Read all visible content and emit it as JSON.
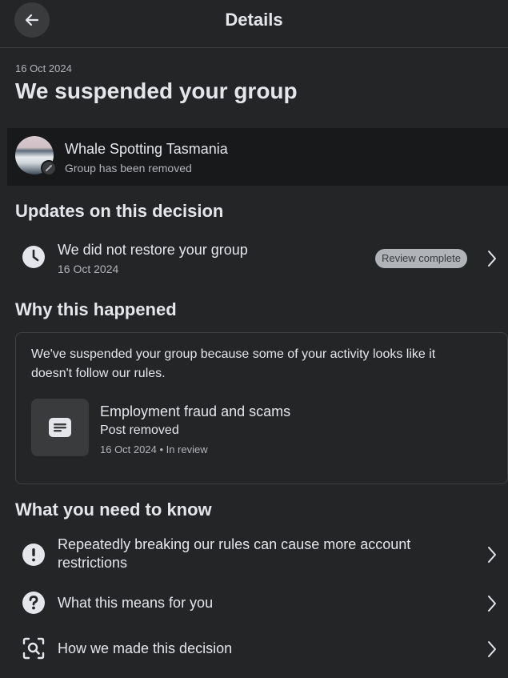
{
  "header": {
    "title": "Details"
  },
  "notice": {
    "date": "16 Oct 2024",
    "title": "We suspended your group"
  },
  "group": {
    "name": "Whale Spotting Tasmania",
    "status": "Group has been removed"
  },
  "updates": {
    "heading": "Updates on this decision",
    "item": {
      "title": "We did not restore your group",
      "date": "16 Oct 2024",
      "badge": "Review complete"
    }
  },
  "why": {
    "heading": "Why this happened",
    "text": "We've suspended your group because some of your activity looks like it doesn't follow our rules.",
    "post": {
      "title": "Employment fraud and scams",
      "status": "Post removed",
      "meta": "16 Oct 2024 • In review"
    }
  },
  "know": {
    "heading": "What you need to know",
    "items": [
      {
        "label": "Repeatedly breaking our rules can cause more account restrictions",
        "icon": "exclamation-icon"
      },
      {
        "label": "What this means for you",
        "icon": "question-icon"
      },
      {
        "label": "How we made this decision",
        "icon": "magnify-scan-icon"
      }
    ]
  }
}
